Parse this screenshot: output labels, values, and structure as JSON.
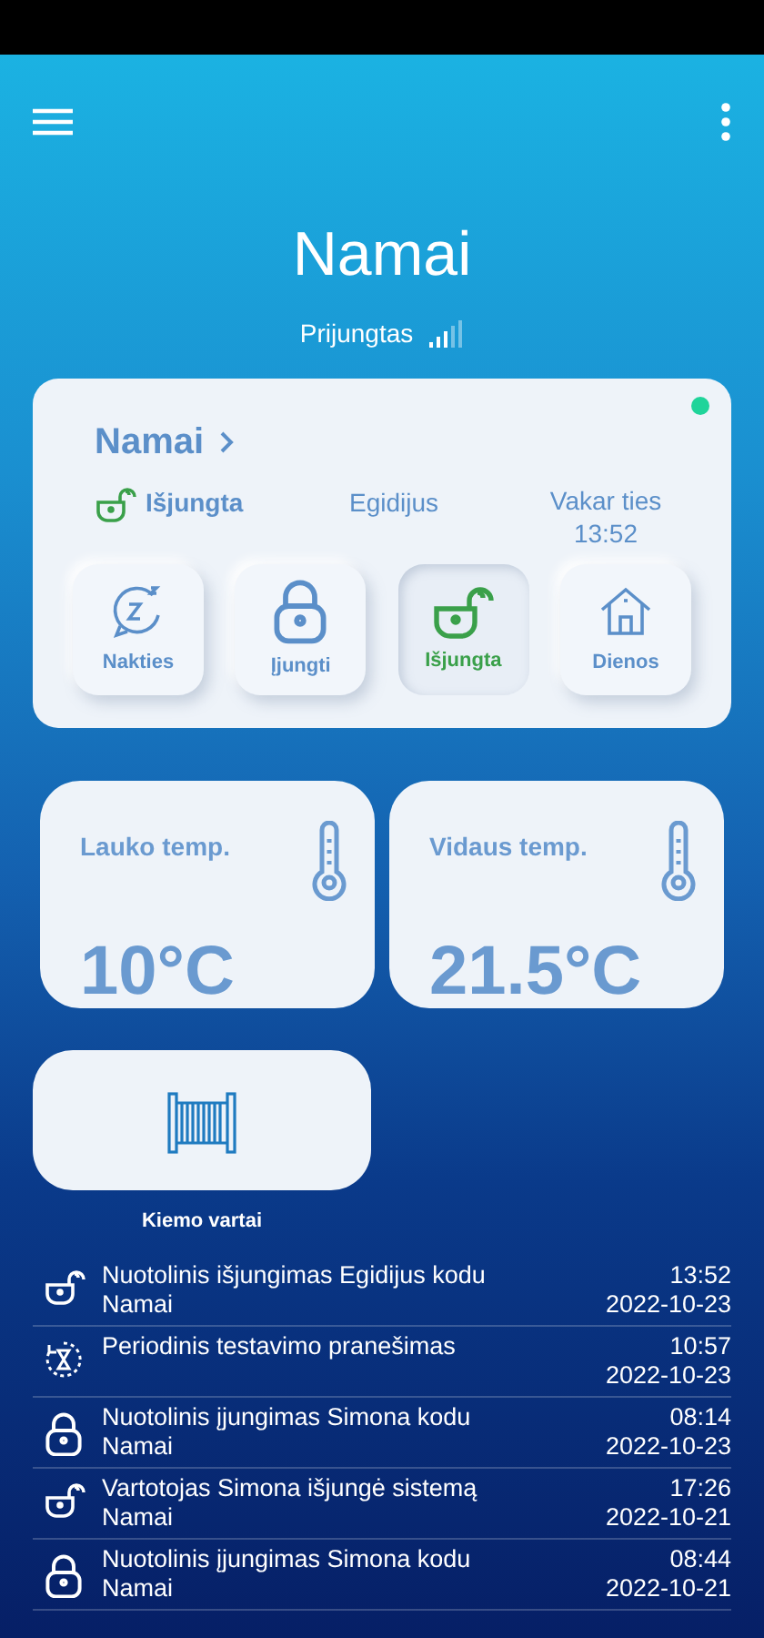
{
  "header": {
    "title": "Namai",
    "connection": "Prijungtas"
  },
  "system": {
    "name": "Namai",
    "online": true,
    "status": {
      "kind": "disarm",
      "label": "Išjungta"
    },
    "user": "Egidijus",
    "when": "Vakar ties",
    "time": "13:52",
    "modes": [
      {
        "kind": "night",
        "label": "Nakties",
        "selected": false
      },
      {
        "kind": "arm",
        "label": "Įjungti",
        "selected": false
      },
      {
        "kind": "disarm",
        "label": "Išjungta",
        "selected": true
      },
      {
        "kind": "day",
        "label": "Dienos",
        "selected": false
      }
    ]
  },
  "sensors": [
    {
      "label": "Lauko temp.",
      "value": "10°C"
    },
    {
      "label": "Vidaus temp.",
      "value": "21.5°C"
    }
  ],
  "devices": [
    {
      "label": "Kiemo vartai"
    }
  ],
  "events": [
    {
      "kind": "disarm",
      "text": "Nuotolinis išjungimas Egidijus kodu",
      "place": "Namai",
      "time": "13:52",
      "date": "2022-10-23"
    },
    {
      "kind": "test",
      "text": "Periodinis testavimo pranešimas",
      "time": "10:57",
      "date": "2022-10-23"
    },
    {
      "kind": "arm",
      "text": "Nuotolinis įjungimas Simona kodu",
      "place": "Namai",
      "time": "08:14",
      "date": "2022-10-23"
    },
    {
      "kind": "disarm",
      "text": "Vartotojas Simona išjungė sistemą",
      "place": "Namai",
      "time": "17:26",
      "date": "2022-10-21"
    },
    {
      "kind": "arm",
      "text": "Nuotolinis įjungimas Simona kodu",
      "place": "Namai",
      "time": "08:44",
      "date": "2022-10-21"
    }
  ]
}
